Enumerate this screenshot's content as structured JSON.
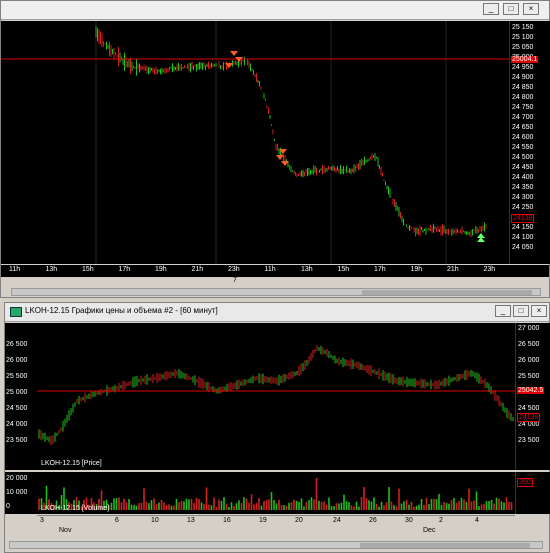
{
  "window1": {
    "buttons": [
      "_",
      "□",
      "×"
    ],
    "price_axis": [
      "25 150",
      "25 100",
      "25 050",
      "25 000",
      "24 950",
      "24 900",
      "24 850",
      "24 800",
      "24 750",
      "24 700",
      "24 650",
      "24 600",
      "24 550",
      "24 500",
      "24 450",
      "24 400",
      "24 350",
      "24 300",
      "24 250",
      "24 200",
      "24 150",
      "24 100",
      "24 050"
    ],
    "current_price_tag": "25004.1",
    "last_price_tag": "24138",
    "time_axis": [
      "11h",
      "13h",
      "15h",
      "17h",
      "19h",
      "21h",
      "23h",
      "11h",
      "13h",
      "15h",
      "17h",
      "19h",
      "21h",
      "23h"
    ],
    "date_axis": [
      "7"
    ]
  },
  "window2": {
    "title": "LKOH-12.15 Графики цены и объема #2 - [60 минут]",
    "buttons": [
      "_",
      "□",
      "×"
    ],
    "price_axis": [
      "27 000",
      "26 500",
      "26 000",
      "25 500",
      "25 000",
      "24 500",
      "24 000",
      "23 500"
    ],
    "current_price_tag": "25042.5",
    "last_price_tag": "24138",
    "price_series_label": "LKOH-12.15 [Price]",
    "volume_axis": [
      "20 000",
      "10 000",
      "0"
    ],
    "volume_tag": "350",
    "volume_series_label": "LKOH-12.15 [Volume]",
    "day_axis": [
      "3",
      "6",
      "10",
      "13",
      "16",
      "19",
      "20",
      "24",
      "26",
      "30",
      "2",
      "4"
    ],
    "month_axis": [
      "Nov",
      "Dec"
    ]
  },
  "colors": {
    "up": "#1fbf1f",
    "down": "#d42020",
    "level_line": "#e00000",
    "signal_sell": "#ff5a2a",
    "signal_buy": "#66ff66"
  }
}
